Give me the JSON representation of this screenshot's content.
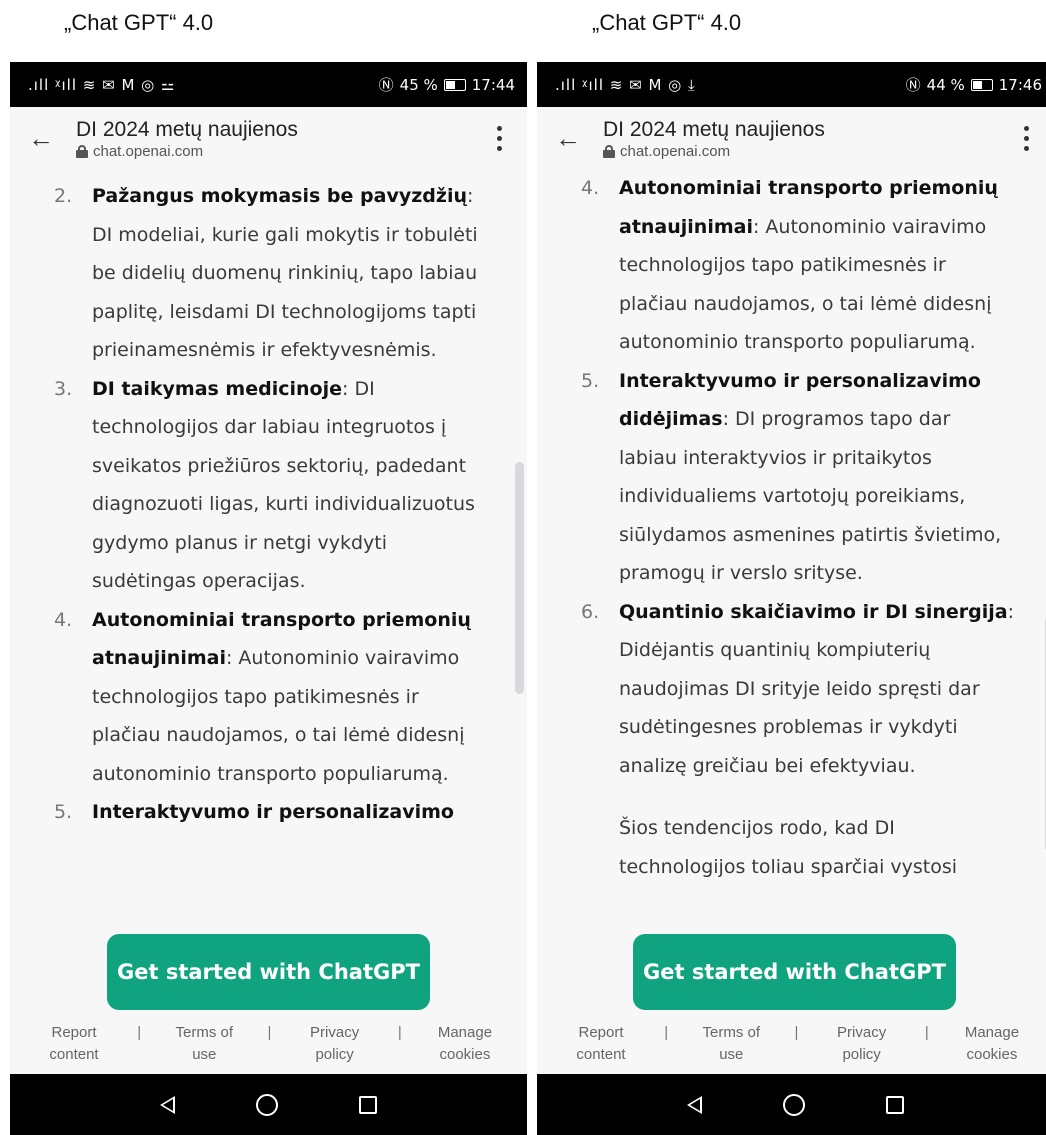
{
  "captions": {
    "left": "„Chat GPT“ 4.0",
    "right": "„Chat GPT“ 4.0"
  },
  "phones": [
    {
      "status": {
        "icons": ".ıll ᵡıll ≋ ✉ M ◎ ⚍",
        "battery": "45 %",
        "time": "17:44"
      },
      "url_bar": {
        "title": "DI 2024 metų naujienos",
        "domain": "chat.openai.com"
      },
      "items": [
        {
          "number": "2.",
          "bold": "Pažangus mokymasis be pavyzdžių",
          "text": ": DI modeliai, kurie gali mokytis ir tobulėti be didelių duomenų rinkinių, tapo labiau paplitę, leisdami DI technologijoms tapti prieinamesnėmis ir efektyvesnėmis."
        },
        {
          "number": "3.",
          "bold": "DI taikymas medicinoje",
          "text": ": DI technologijos dar labiau integruotos į sveikatos priežiūros sektorių, padedant diagnozuoti ligas, kurti individualizuotus gydymo planus ir netgi vykdyti sudėtingas operacijas."
        },
        {
          "number": "4.",
          "bold": "Autonominiai transporto priemonių atnaujinimai",
          "text": ": Autonominio vairavimo technologijos tapo patikimesnės ir plačiau naudojamos, o tai lėmė didesnį autonominio transporto populiarumą."
        },
        {
          "number": "5.",
          "bold": "Interaktyvumo ir personalizavimo",
          "text": ""
        }
      ],
      "cta": "Get started with ChatGPT",
      "footer": {
        "report": "Report content",
        "terms": "Terms of use",
        "privacy": "Privacy policy",
        "cookies": "Manage cookies",
        "separator": "|"
      }
    },
    {
      "status": {
        "icons": ".ıll ᵡıll ≋ ✉ M ◎ ⤓",
        "battery": "44 %",
        "time": "17:46"
      },
      "url_bar": {
        "title": "DI 2024 metų naujienos",
        "domain": "chat.openai.com"
      },
      "items": [
        {
          "number": "4.",
          "bold": "Autonominiai transporto priemonių atnaujinimai",
          "text": ": Autonominio vairavimo technologijos tapo patikimesnės ir plačiau naudojamos, o tai lėmė didesnį autonominio transporto populiarumą."
        },
        {
          "number": "5.",
          "bold": "Interaktyvumo ir personalizavimo didėjimas",
          "text": ": DI programos tapo dar labiau interaktyvios ir pritaikytos individualiems vartotojų poreikiams, siūlydamos asmenines patirtis švietimo, pramogų ir verslo srityse."
        },
        {
          "number": "6.",
          "bold": "Quantinio skaičiavimo ir DI sinergija",
          "text": ": Didėjantis quantinių kompiuterių naudojimas DI srityje leido spręsti dar sudėtingesnes problemas ir vykdyti analizę greičiau bei efektyviau."
        }
      ],
      "paragraph": "Šios tendencijos rodo, kad DI technologijos toliau sparčiai vystosi",
      "cta": "Get started with ChatGPT",
      "footer": {
        "report": "Report content",
        "terms": "Terms of use",
        "privacy": "Privacy policy",
        "cookies": "Manage cookies",
        "separator": "|"
      }
    }
  ]
}
